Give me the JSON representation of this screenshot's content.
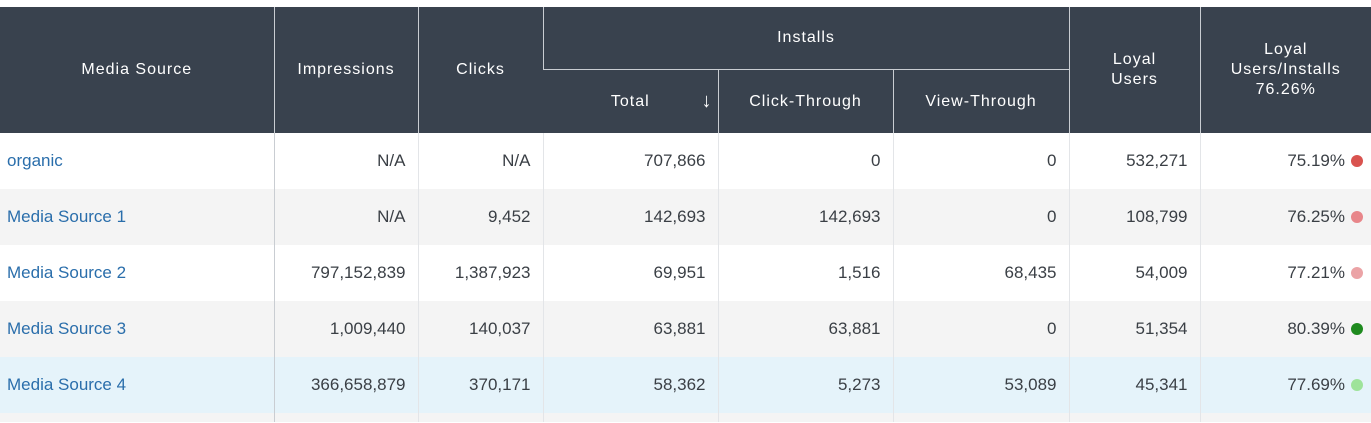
{
  "headers": {
    "media_source": "Media Source",
    "impressions": "Impressions",
    "clicks": "Clicks",
    "installs": "Installs",
    "total": "Total",
    "sort_arrow": "↓",
    "click_through": "Click-Through",
    "view_through": "View-Through",
    "loyal_users_line1": "Loyal",
    "loyal_users_line2": "Users",
    "ratio_line1": "Loyal",
    "ratio_line2": "Users/Installs",
    "ratio_line3": "76.26%"
  },
  "rows": [
    {
      "source": "organic",
      "impressions": "N/A",
      "clicks": "N/A",
      "total": "707,866",
      "click_through": "0",
      "view_through": "0",
      "loyal_users": "532,271",
      "ratio": "75.19%",
      "dot_color": "#d9534f"
    },
    {
      "source": "Media Source 1",
      "impressions": "N/A",
      "clicks": "9,452",
      "total": "142,693",
      "click_through": "142,693",
      "view_through": "0",
      "loyal_users": "108,799",
      "ratio": "76.25%",
      "dot_color": "#e8868a"
    },
    {
      "source": "Media Source 2",
      "impressions": "797,152,839",
      "clicks": "1,387,923",
      "total": "69,951",
      "click_through": "1,516",
      "view_through": "68,435",
      "loyal_users": "54,009",
      "ratio": "77.21%",
      "dot_color": "#eba3a6"
    },
    {
      "source": "Media Source 3",
      "impressions": "1,009,440",
      "clicks": "140,037",
      "total": "63,881",
      "click_through": "63,881",
      "view_through": "0",
      "loyal_users": "51,354",
      "ratio": "80.39%",
      "dot_color": "#1e8a1e"
    },
    {
      "source": "Media Source 4",
      "impressions": "366,658,879",
      "clicks": "370,171",
      "total": "58,362",
      "click_through": "5,273",
      "view_through": "53,089",
      "loyal_users": "45,341",
      "ratio": "77.69%",
      "dot_color": "#9ee39a"
    }
  ]
}
